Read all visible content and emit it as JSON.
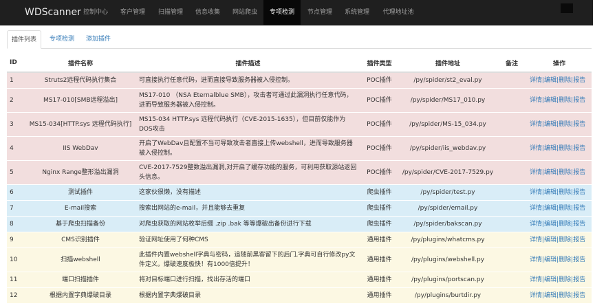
{
  "navbar": {
    "brand": "WDScanner",
    "items": [
      {
        "label": "控制中心"
      },
      {
        "label": "客户管理"
      },
      {
        "label": "扫描管理"
      },
      {
        "label": "信息收集"
      },
      {
        "label": "网站爬虫"
      },
      {
        "label": "专项检测",
        "active": true
      },
      {
        "label": "节点管理"
      },
      {
        "label": "系统管理"
      },
      {
        "label": "代理地址池"
      }
    ]
  },
  "tabs": [
    {
      "label": "插件列表",
      "active": true
    },
    {
      "label": "专项检测"
    },
    {
      "label": "添加插件"
    }
  ],
  "table": {
    "headers": {
      "id": "ID",
      "name": "插件名称",
      "desc": "插件描述",
      "type": "插件类型",
      "path": "插件地址",
      "note": "备注",
      "ops": "操作"
    },
    "ops": {
      "detail": "详情",
      "edit": "编辑",
      "delete": "删除",
      "report": "报告",
      "sep": "|"
    },
    "rows": [
      {
        "id": "1",
        "name": "Struts2远程代码执行集合",
        "desc": "可直接执行任意代码，进而直接导致服务器被入侵控制。",
        "type": "POC插件",
        "path": "/py/spider/st2_eval.py",
        "note": "",
        "category": "poc"
      },
      {
        "id": "2",
        "name": "MS17-010[SMB远程溢出]",
        "desc": "MS17-010 （NSA Eternalblue SMB），攻击者可通过此漏洞执行任意代码，进而导致服务器被入侵控制。",
        "type": "POC插件",
        "path": "/py/spider/MS17_010.py",
        "note": "",
        "category": "poc"
      },
      {
        "id": "3",
        "name": "MS15-034[HTTP.sys 远程代码执行]",
        "desc": "MS15-034 HTTP.sys 远程代码执行（CVE-2015-1635），但目前仅能作为DOS攻击",
        "type": "POC插件",
        "path": "/py/spider/MS-15_034.py",
        "note": "",
        "category": "poc"
      },
      {
        "id": "4",
        "name": "IIS WebDav",
        "desc": "开启了WebDav且配置不当可导致攻击者直接上传webshell，进而导致服务器被入侵控制。",
        "type": "POC插件",
        "path": "/py/spider/iis_webdav.py",
        "note": "",
        "category": "poc"
      },
      {
        "id": "5",
        "name": "Nginx Range整形溢出漏洞",
        "desc": "CVE-2017-7529整数溢出漏洞,对开启了缓存功能的服务，可利用获取源站返回头信息。",
        "type": "POC插件",
        "path": "/py/spider/CVE-2017-7529.py",
        "note": "",
        "category": "poc"
      },
      {
        "id": "6",
        "name": "测试插件",
        "desc": "这家伙很懒，没有描述",
        "type": "爬虫插件",
        "path": "/py/spider/test.py",
        "note": "",
        "category": "spider"
      },
      {
        "id": "7",
        "name": "E-mail搜索",
        "desc": "搜索出网站的e-mail，并且能够去重复",
        "type": "爬虫插件",
        "path": "/py/spider/email.py",
        "note": "",
        "category": "spider"
      },
      {
        "id": "8",
        "name": "基于爬虫扫描备份",
        "desc": "对爬虫获取的网站枚举后缀 .zip .bak 等等爆破出备份进行下载",
        "type": "爬虫插件",
        "path": "/py/spider/bakscan.py",
        "note": "",
        "category": "spider"
      },
      {
        "id": "9",
        "name": "CMS识别插件",
        "desc": "验证网址使用了何种CMS",
        "type": "通用插件",
        "path": "/py/plugins/whatcms.py",
        "note": "",
        "category": "general"
      },
      {
        "id": "10",
        "name": "扫描webshell",
        "desc": "此插件内置webshell字典与密码，追随前黑客留下的后门,字典可自行修改py文件定义。爆破速度极快！有1000倍提升！",
        "type": "通用插件",
        "path": "/py/plugins/webshell.py",
        "note": "",
        "category": "general"
      },
      {
        "id": "11",
        "name": "端口扫描插件",
        "desc": "将对目标端口进行扫描，找出存活的端口",
        "type": "通用插件",
        "path": "/py/plugins/portscan.py",
        "note": "",
        "category": "general"
      },
      {
        "id": "12",
        "name": "根据内置字典爆破目录",
        "desc": "根据内置字典爆破目录",
        "type": "通用插件",
        "path": "/py/plugins/burtdir.py",
        "note": "",
        "category": "general"
      }
    ]
  }
}
